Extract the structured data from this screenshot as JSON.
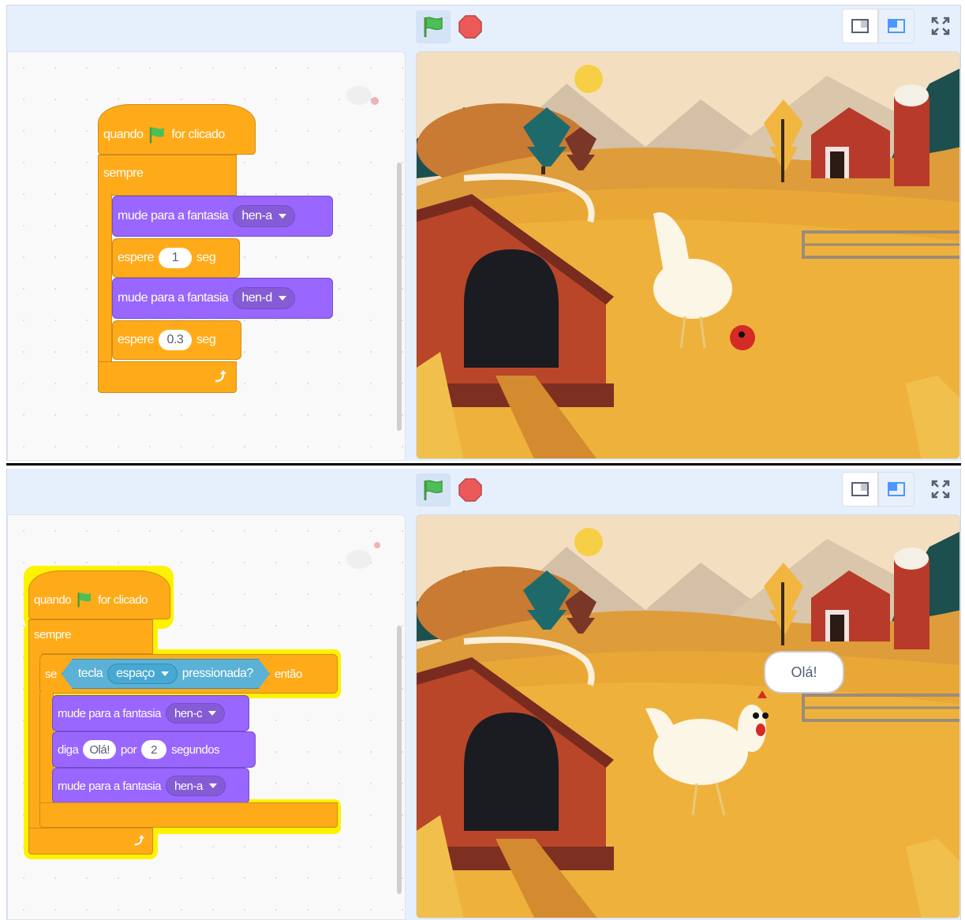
{
  "top": {
    "script": {
      "hat": {
        "before": "quando",
        "after": "for clicado"
      },
      "forever": "sempre",
      "costume1": {
        "label": "mude para a fantasia",
        "value": "hen-a"
      },
      "wait1": {
        "label": "espere",
        "value": "1",
        "unit": "seg"
      },
      "costume2": {
        "label": "mude para a fantasia",
        "value": "hen-d"
      },
      "wait2": {
        "label": "espere",
        "value": "0.3",
        "unit": "seg"
      }
    }
  },
  "bottom": {
    "script": {
      "hat": {
        "before": "quando",
        "after": "for clicado"
      },
      "forever": "sempre",
      "if": {
        "label": "se",
        "then": "então"
      },
      "sensing": {
        "key_label": "tecla",
        "key": "espaço",
        "pressed": "pressionada?"
      },
      "costume1": {
        "label": "mude para a fantasia",
        "value": "hen-c"
      },
      "say": {
        "label": "diga",
        "text": "Olá!",
        "for": "por",
        "secs": "2",
        "unit": "segundos"
      },
      "costume2": {
        "label": "mude para a fantasia",
        "value": "hen-a"
      }
    },
    "speech_bubble": "Olá!"
  },
  "icons": {
    "flag": "green-flag-icon",
    "stop": "stop-icon",
    "small_stage": "small-stage-icon",
    "normal_stage": "normal-stage-icon",
    "fullscreen": "fullscreen-icon",
    "loop": "loop-arrow-icon"
  },
  "colors": {
    "control": "#ffab19",
    "looks": "#9966ff",
    "sensing": "#5cb1d6",
    "glow": "#fff200",
    "flag": "#4cbf56",
    "stop": "#ec5959"
  }
}
